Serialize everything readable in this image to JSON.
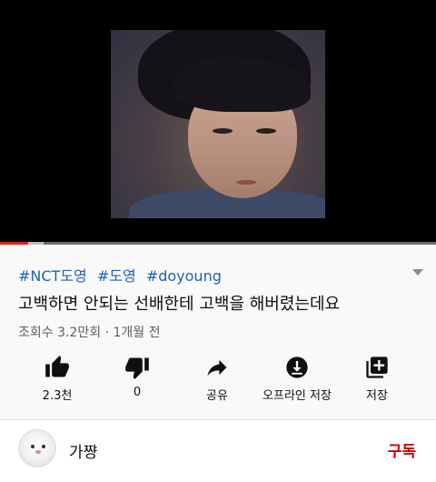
{
  "player": {
    "progress_played_fraction": 0.065,
    "progress_buffered_fraction": 0.1
  },
  "video": {
    "hashtags": [
      "#NCT도영",
      "#도영",
      "#doyoung"
    ],
    "title": "고백하면 안되는 선배한테 고백을 해버렸는데요",
    "meta": "조회수 3.2만회 · 1개월 전"
  },
  "actions": [
    {
      "icon": "thumbs-up-icon",
      "label": "2.3천"
    },
    {
      "icon": "thumbs-down-icon",
      "label": "0"
    },
    {
      "icon": "share-icon",
      "label": "공유"
    },
    {
      "icon": "download-icon",
      "label": "오프라인 저장"
    },
    {
      "icon": "playlist-add-icon",
      "label": "저장"
    }
  ],
  "channel": {
    "name": "가쨩",
    "subscribe_label": "구독"
  },
  "colors": {
    "link": "#1c62b9",
    "subscribe": "#cc0000",
    "progress": "#e62117"
  }
}
